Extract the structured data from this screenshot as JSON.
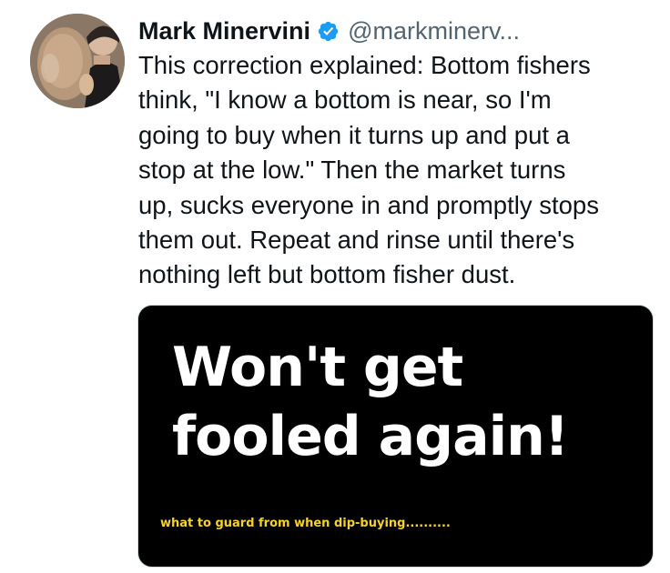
{
  "author": {
    "name": "Mark Minervini",
    "handle": "@markminerv..."
  },
  "tweet": {
    "lines": [
      "This correction explained: Bottom fishers",
      "think, \"I know a bottom is near, so I'm",
      "going to buy when it turns up and put a",
      "stop at the low.\" Then the market turns",
      "up, sucks everyone in and promptly stops",
      "them out. Repeat and rinse until there's",
      "nothing left but bottom fisher dust."
    ]
  },
  "media": {
    "headline_line1": "Won't get",
    "headline_line2": "fooled again!",
    "caption": "what to guard from when dip-buying.........."
  },
  "colors": {
    "verified_badge": "#1d9bf0",
    "text": "#0f1419",
    "handle": "#536471",
    "caption": "#f7d22a",
    "media_background": "#000000"
  },
  "icons": {
    "verified": "verified-badge-icon"
  }
}
